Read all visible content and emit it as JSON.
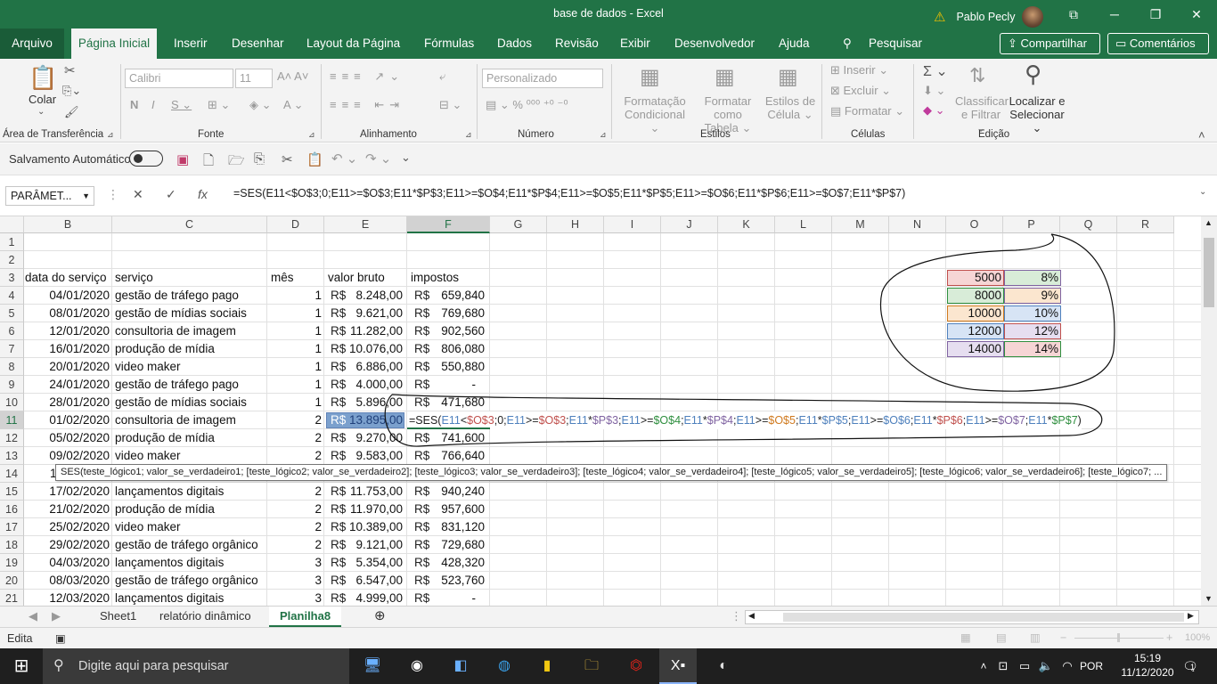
{
  "window": {
    "title": "base de dados  -  Excel",
    "user": "Pablo Pecly",
    "min": "─",
    "max": "❐",
    "close": "✕",
    "ribbon_display": "⧉"
  },
  "menu": {
    "file": "Arquivo",
    "tabs": [
      "Página Inicial",
      "Inserir",
      "Desenhar",
      "Layout da Página",
      "Fórmulas",
      "Dados",
      "Revisão",
      "Exibir",
      "Desenvolvedor",
      "Ajuda"
    ],
    "search": "Pesquisar",
    "share": "Compartilhar",
    "comments": "Comentários"
  },
  "ribbon": {
    "clipboard": {
      "label": "Área de Transferência",
      "paste": "Colar"
    },
    "font": {
      "label": "Fonte",
      "name": "Calibri",
      "size": "11"
    },
    "alignment": {
      "label": "Alinhamento"
    },
    "number": {
      "label": "Número",
      "format": "Personalizado"
    },
    "styles": {
      "label": "Estilos",
      "cond1": "Formatação",
      "cond2": "Condicional",
      "table1": "Formatar como",
      "table2": "Tabela",
      "cell1": "Estilos de",
      "cell2": "Célula"
    },
    "cells": {
      "label": "Células",
      "insert": "Inserir",
      "delete": "Excluir",
      "format": "Formatar"
    },
    "editing": {
      "label": "Edição",
      "sort1": "Classificar",
      "sort2": "e Filtrar",
      "find1": "Localizar e",
      "find2": "Selecionar"
    }
  },
  "qat": {
    "autosave": "Salvamento Automático"
  },
  "formula_bar": {
    "name_box": "PARÂMET...",
    "cancel": "✕",
    "enter": "✓",
    "fx": "fx",
    "formula": "=SES(E11<$O$3;0;E11>=$O$3;E11*$P$3;E11>=$O$4;E11*$P$4;E11>=$O$5;E11*$P$5;E11>=$O$6;E11*$P$6;E11>=$O$7;E11*$P$7)"
  },
  "columns": [
    "B",
    "C",
    "D",
    "E",
    "F",
    "G",
    "H",
    "I",
    "J",
    "K",
    "L",
    "M",
    "N",
    "O",
    "P",
    "Q",
    "R"
  ],
  "rows": [
    "1",
    "2",
    "3",
    "4",
    "5",
    "6",
    "7",
    "8",
    "9",
    "10",
    "11",
    "12",
    "13",
    "14",
    "15",
    "16",
    "17",
    "18",
    "19",
    "20",
    "21"
  ],
  "headers": {
    "date": "data do serviço",
    "service": "serviço",
    "month": "mês",
    "gross": "valor bruto",
    "tax": "impostos"
  },
  "currency": "R$",
  "table": [
    {
      "row": 4,
      "date": "04/01/2020",
      "service": "gestão de tráfego pago",
      "month": "1",
      "gross": "8.248,00",
      "tax": "659,840"
    },
    {
      "row": 5,
      "date": "08/01/2020",
      "service": "gestão de mídias sociais",
      "month": "1",
      "gross": "9.621,00",
      "tax": "769,680"
    },
    {
      "row": 6,
      "date": "12/01/2020",
      "service": "consultoria de imagem",
      "month": "1",
      "gross": "11.282,00",
      "tax": "902,560"
    },
    {
      "row": 7,
      "date": "16/01/2020",
      "service": "produção de mídia",
      "month": "1",
      "gross": "10.076,00",
      "tax": "806,080"
    },
    {
      "row": 8,
      "date": "20/01/2020",
      "service": "video maker",
      "month": "1",
      "gross": "6.886,00",
      "tax": "550,880"
    },
    {
      "row": 9,
      "date": "24/01/2020",
      "service": "gestão de tráfego pago",
      "month": "1",
      "gross": "4.000,00",
      "tax": "-"
    },
    {
      "row": 10,
      "date": "28/01/2020",
      "service": "gestão de mídias sociais",
      "month": "1",
      "gross": "5.896,00",
      "tax": "471,680"
    },
    {
      "row": 11,
      "date": "01/02/2020",
      "service": "consultoria de imagem",
      "month": "2",
      "gross": "13.895,00",
      "tax": ""
    },
    {
      "row": 12,
      "date": "05/02/2020",
      "service": "produção de mídia",
      "month": "2",
      "gross": "9.270,00",
      "tax": "741,600"
    },
    {
      "row": 13,
      "date": "09/02/2020",
      "service": "video maker",
      "month": "2",
      "gross": "9.583,00",
      "tax": "766,640"
    },
    {
      "row": 15,
      "date": "17/02/2020",
      "service": "lançamentos digitais",
      "month": "2",
      "gross": "11.753,00",
      "tax": "940,240"
    },
    {
      "row": 16,
      "date": "21/02/2020",
      "service": "produção de mídia",
      "month": "2",
      "gross": "11.970,00",
      "tax": "957,600"
    },
    {
      "row": 17,
      "date": "25/02/2020",
      "service": "video maker",
      "month": "2",
      "gross": "10.389,00",
      "tax": "831,120"
    },
    {
      "row": 18,
      "date": "29/02/2020",
      "service": "gestão de tráfego orgânico",
      "month": "2",
      "gross": "9.121,00",
      "tax": "729,680"
    },
    {
      "row": 19,
      "date": "04/03/2020",
      "service": "lançamentos digitais",
      "month": "3",
      "gross": "5.354,00",
      "tax": "428,320"
    },
    {
      "row": 20,
      "date": "08/03/2020",
      "service": "gestão de tráfego orgânico",
      "month": "3",
      "gross": "6.547,00",
      "tax": "523,760"
    },
    {
      "row": 21,
      "date": "12/03/2020",
      "service": "lançamentos digitais",
      "month": "3",
      "gross": "4.999,00",
      "tax": "-"
    }
  ],
  "row14_partial": "1",
  "params": [
    {
      "limit": "5000",
      "rate": "8%"
    },
    {
      "limit": "8000",
      "rate": "9%"
    },
    {
      "limit": "10000",
      "rate": "10%"
    },
    {
      "limit": "12000",
      "rate": "12%"
    },
    {
      "limit": "14000",
      "rate": "14%"
    }
  ],
  "edit_cell_formula": "=SES(E11<$O$3;0;E11>=$O$3;E11*$P$3;E11>=$O$4;E11*$P$4;E11>=$O$5;E11*$P$5;E11>=$O$6;E11*$P$6;E11>=$O$7;E11*$P$7)",
  "tooltip": "SES(teste_lógico1; valor_se_verdadeiro1; [teste_lógico2; valor_se_verdadeiro2]; [teste_lógico3; valor_se_verdadeiro3]; [teste_lógico4; valor_se_verdadeiro4]; [teste_lógico5; valor_se_verdadeiro5]; [teste_lógico6; valor_se_verdadeiro6]; [teste_lógico7; ...",
  "sheets": [
    "Sheet1",
    "relatório dinâmico",
    "Planilha8"
  ],
  "active_sheet": "Planilha8",
  "status": {
    "mode": "Edita",
    "zoom": "100%"
  },
  "taskbar": {
    "search_placeholder": "Digite aqui para pesquisar",
    "lang": "POR",
    "time": "15:19",
    "date": "11/12/2020",
    "notifications": "1"
  },
  "colors": {
    "excel_green": "#217346",
    "ref_red": "#c0504d",
    "ref_blue": "#4f81bd",
    "ref_green": "#2f8f3f",
    "ref_purple": "#8064a2",
    "ref_orange": "#d07a1f"
  }
}
